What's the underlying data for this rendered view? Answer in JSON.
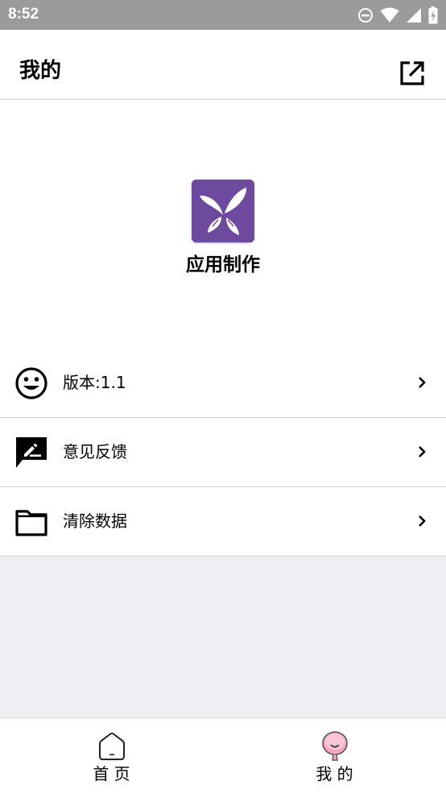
{
  "status_bar": {
    "time": "8:52",
    "icons": [
      "do-not-disturb-icon",
      "wifi-icon",
      "cell-signal-icon",
      "battery-charging-icon"
    ]
  },
  "header": {
    "title": "我的",
    "action_icon": "open-in-new-icon"
  },
  "profile": {
    "app_name": "应用制作",
    "logo_color": "#6e4a9e"
  },
  "menu": {
    "items": [
      {
        "label": "版本:1.1",
        "icon": "smiley-face-icon"
      },
      {
        "label": "意见反馈",
        "icon": "feedback-edit-icon"
      },
      {
        "label": "清除数据",
        "icon": "folder-icon"
      }
    ]
  },
  "bottom_nav": {
    "items": [
      {
        "label": "首 页",
        "icon": "home-icon",
        "active": false
      },
      {
        "label": "我 的",
        "icon": "profile-balloon-icon",
        "active": true
      }
    ]
  },
  "colors": {
    "status_bar": "#9b9b9b",
    "content_gray": "#eeeef3",
    "accent_pink": "#f7a8c0"
  }
}
